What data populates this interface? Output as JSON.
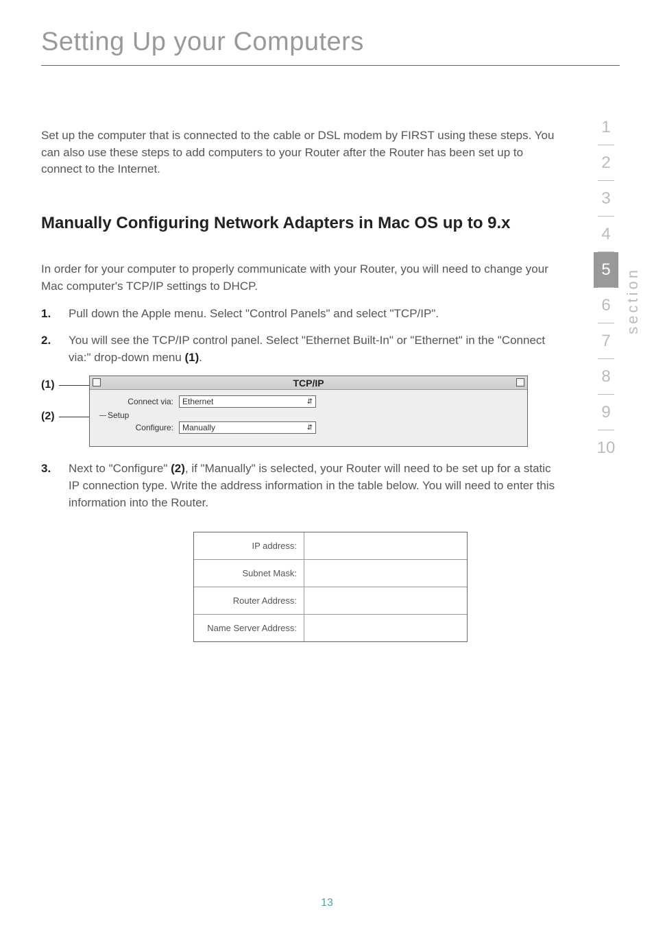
{
  "chapter_title": "Setting Up your Computers",
  "intro": "Set up the computer that is connected to the cable or DSL modem by FIRST using these steps. You can also use these steps to add computers to your Router after the Router has been set up to connect to the Internet.",
  "section_heading": "Manually Configuring Network Adapters in Mac OS up to 9.x",
  "para1": "In order for your computer to properly communicate with your Router, you will need to change your Mac computer's TCP/IP settings to DHCP.",
  "steps": {
    "s1": "Pull down the Apple menu. Select \"Control Panels\" and select \"TCP/IP\".",
    "s2_a": "You will see the TCP/IP control panel. Select \"Ethernet Built-In\" or \"Ethernet\" in the \"Connect via:\" drop-down menu ",
    "s2_ref": "(1)",
    "s2_b": ".",
    "s3_a": "Next to \"Configure\" ",
    "s3_ref": "(2)",
    "s3_b": ", if \"Manually\" is selected, your Router will need to be set up for a static IP connection type. Write the address information in the table below. You will need to enter this information into the Router."
  },
  "callouts": {
    "c1": "(1)",
    "c2": "(2)"
  },
  "tcpip": {
    "title": "TCP/IP",
    "connect_label": "Connect via:",
    "connect_value": "Ethernet",
    "setup_label": "Setup",
    "configure_label": "Configure:",
    "configure_value": "Manually"
  },
  "ip_table": {
    "r1": "IP address:",
    "r2": "Subnet Mask:",
    "r3": "Router Address:",
    "r4": "Name Server Address:"
  },
  "sidenav": {
    "items": [
      "1",
      "2",
      "3",
      "4",
      "5",
      "6",
      "7",
      "8",
      "9",
      "10"
    ],
    "active_index": 4,
    "label": "section"
  },
  "page_number": "13"
}
